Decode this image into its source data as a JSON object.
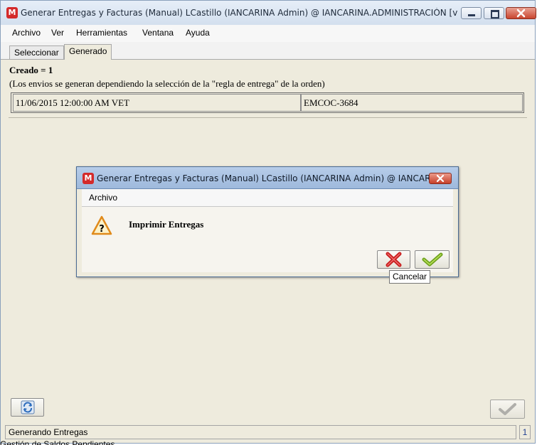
{
  "window": {
    "title": "Generar Entregas y Facturas (Manual)  LCastillo (IANCARINA Admin) @ IANCARINA.ADMINISTRACIÓN [vmadempi...",
    "icon_letter": "M"
  },
  "menu": [
    "Archivo",
    "Ver",
    "Herramientas",
    "Ventana",
    "Ayuda"
  ],
  "tabs": [
    "Seleccionar",
    "Generado"
  ],
  "result": {
    "created": "Creado = 1",
    "note": "(Los envios se generan dependiendo la selección de la \"regla de entrega\" de la orden)",
    "row": [
      "11/06/2015 12:00:00 AM VET",
      "EMCOC-3684"
    ]
  },
  "status": {
    "text": "Generando Entregas",
    "count": "1"
  },
  "below_window_text": "Gestión de Saldos Pendientes",
  "dialog": {
    "title": "Generar Entregas y Facturas (Manual)  LCastillo (IANCARINA Admin) @ IANCARINA.A...",
    "menu_label": "Archivo",
    "message": "Imprimir Entregas",
    "tooltip": "Cancelar"
  },
  "colors": {
    "accent_red": "#d42a2a",
    "ok_green": "#7fb52b",
    "warning_orange": "#f0a020"
  }
}
